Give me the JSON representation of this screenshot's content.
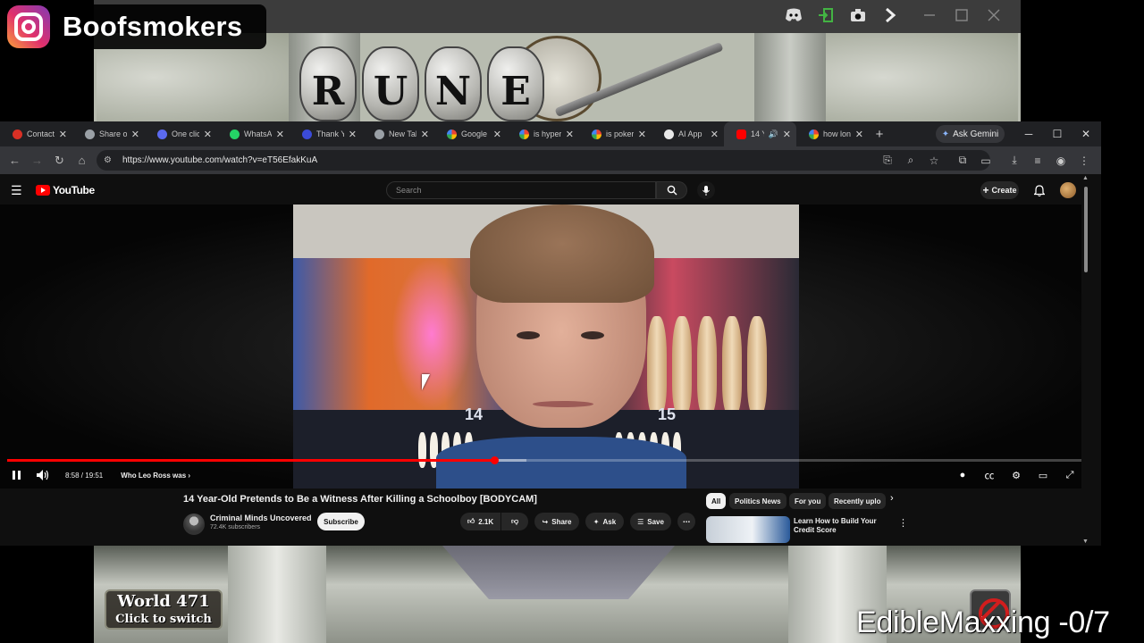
{
  "overlay": {
    "instagram_handle": "Boofsmokers",
    "watermark": "EdibleMaxxing -0/7"
  },
  "game": {
    "logo_letters": [
      "R",
      "U",
      "N",
      "E"
    ],
    "world_line1": "World 471",
    "world_line2": "Click to switch"
  },
  "outer_window": {
    "icons": [
      "discord-icon",
      "login-icon",
      "camera-icon",
      "arrow-right-icon",
      "minimize-icon",
      "maximize-icon",
      "close-icon"
    ]
  },
  "browser": {
    "tabs": [
      {
        "label": "Contact",
        "color": "#d93025",
        "active": false
      },
      {
        "label": "Share or",
        "color": "#9aa0a6",
        "active": false
      },
      {
        "label": "One clic",
        "color": "#5b6af0",
        "active": false
      },
      {
        "label": "WhatsA",
        "color": "#25d366",
        "active": false
      },
      {
        "label": "Thank Y",
        "color": "#3b4bd8",
        "active": false
      },
      {
        "label": "New Tal",
        "color": "#9aa0a6",
        "active": false
      },
      {
        "label": "Google",
        "color": "#fbbc05",
        "active": false
      },
      {
        "label": "is hyper",
        "color": "#4285f4",
        "active": false
      },
      {
        "label": "is poker",
        "color": "#4285f4",
        "active": false
      },
      {
        "label": "AI App",
        "color": "#e8e8e8",
        "active": false
      },
      {
        "label": "14 Y",
        "color": "#ff0000",
        "active": true
      },
      {
        "label": "how lon",
        "color": "#4285f4",
        "active": false
      }
    ],
    "gemini_label": "Ask Gemini",
    "url": "https://www.youtube.com/watch?v=eT56EfakKuA"
  },
  "youtube": {
    "logo_text": "YouTube",
    "search_placeholder": "Search",
    "create_label": "Create",
    "player": {
      "time": "8:58 / 19:51",
      "chapter": "Who Leo Ross was",
      "progress_fraction": 0.452,
      "buffered_fraction": 0.482,
      "overlay_numbers": [
        "14",
        "15"
      ]
    },
    "video_title": "14 Year-Old Pretends to Be a Witness After Killing a Schoolboy [BODYCAM]",
    "channel_name": "Criminal Minds Uncovered",
    "subscribers": "72.4K subscribers",
    "subscribe_label": "Subscribe",
    "like_count": "2.1K",
    "share_label": "Share",
    "ask_label": "Ask",
    "save_label": "Save",
    "chips": [
      "All",
      "Politics News",
      "For you",
      "Recently uplo"
    ],
    "recommended_title": "Learn How to Build Your Credit Score"
  }
}
